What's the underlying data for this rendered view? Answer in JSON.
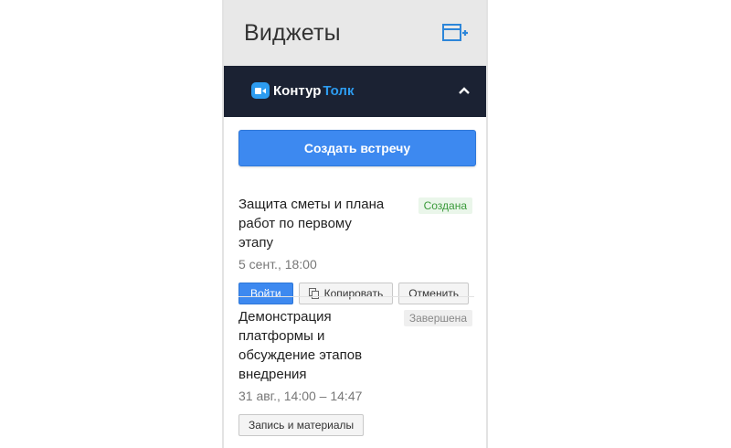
{
  "header": {
    "title": "Виджеты",
    "add_icon": "add-widget-icon"
  },
  "brand": {
    "logo_part1": "Контур",
    "logo_part2": "Толк",
    "collapse_icon": "chevron-up-icon",
    "bar_color": "#1b2233",
    "accent_color": "#2d9cf0"
  },
  "create_button": {
    "label": "Создать встречу",
    "color": "#3d89f0"
  },
  "meetings": [
    {
      "title": "Защита сметы и плана работ по первому этапу",
      "time": "5 сент., 18:00",
      "status": "Создана",
      "buttons": {
        "join": "Войти",
        "copy": "Копировать",
        "cancel": "Отменить"
      }
    },
    {
      "title": "Демонстрация платформы и обсуждение этапов внедрения",
      "time": "31 авг., 14:00 – 14:47",
      "status": "Завершена",
      "buttons": {
        "records": "Запись и материалы"
      }
    }
  ]
}
